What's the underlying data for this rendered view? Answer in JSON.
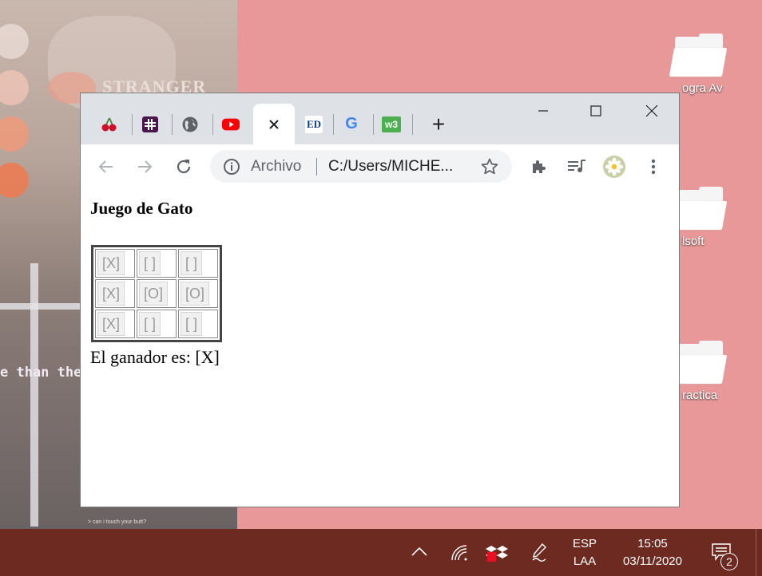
{
  "wallpaper": {
    "poster_text": "STRANGER",
    "phrase_text": "e than the",
    "small_text": "> can i touch your butt?"
  },
  "desktop_icons": [
    {
      "label": "ogra Av"
    },
    {
      "label": "lsoft"
    },
    {
      "label": "ractica"
    }
  ],
  "browser": {
    "tabs": [
      {
        "icon": "cherry-icon"
      },
      {
        "icon": "slack-icon"
      },
      {
        "icon": "globe-icon"
      },
      {
        "icon": "youtube-icon"
      },
      {
        "icon": "close-icon",
        "active": true
      },
      {
        "icon": "ed-icon",
        "text": "ED"
      },
      {
        "icon": "google-icon",
        "text": "G"
      },
      {
        "icon": "w3-icon",
        "text": "w3"
      }
    ],
    "new_tab": "+",
    "address": {
      "scheme_label": "Archivo",
      "url": "C:/Users/MICHE..."
    }
  },
  "page": {
    "title": "Juego de Gato",
    "board": [
      [
        "[X]",
        "[ ]",
        "[ ]"
      ],
      [
        "[X]",
        "[O]",
        "[O]"
      ],
      [
        "[X]",
        "[ ]",
        "[ ]"
      ]
    ],
    "winner_text": "El ganador es: [X]"
  },
  "taskbar": {
    "language_top": "ESP",
    "language_bottom": "LAA",
    "time": "15:05",
    "date": "03/11/2020",
    "notification_count": "2"
  },
  "colors": {
    "desktop": "#e89898",
    "taskbar": "#6d2a20",
    "tabstrip": "#dee1e6"
  }
}
